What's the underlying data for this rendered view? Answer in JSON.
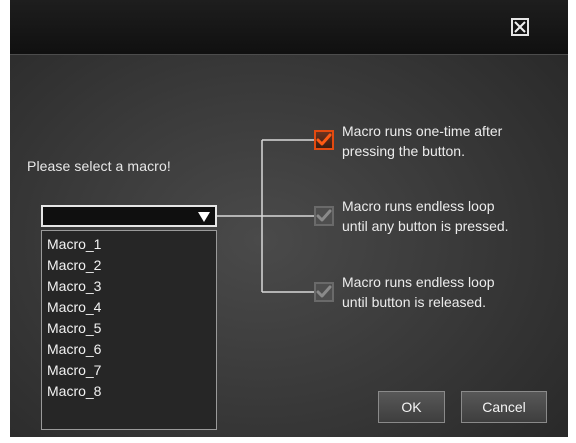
{
  "dialog": {
    "prompt": "Please select a macro!",
    "close_icon": "close-icon",
    "select": {
      "value": "",
      "arrow_icon": "dropdown-arrow-icon"
    },
    "macros": [
      "Macro_1",
      "Macro_2",
      "Macro_3",
      "Macro_4",
      "Macro_5",
      "Macro_6",
      "Macro_7",
      "Macro_8"
    ],
    "options": [
      {
        "label_line1": "Macro runs one-time after",
        "label_line2": "pressing the button.",
        "checked": true,
        "active": true
      },
      {
        "label_line1": "Macro runs endless loop",
        "label_line2": "until any button is pressed.",
        "checked": true,
        "active": false
      },
      {
        "label_line1": "Macro runs endless loop",
        "label_line2": "until button is released.",
        "checked": true,
        "active": false
      }
    ],
    "buttons": {
      "ok": "OK",
      "cancel": "Cancel"
    },
    "colors": {
      "accent": "#e34a10",
      "background": "#3a3a3a",
      "text": "#ececec"
    }
  }
}
